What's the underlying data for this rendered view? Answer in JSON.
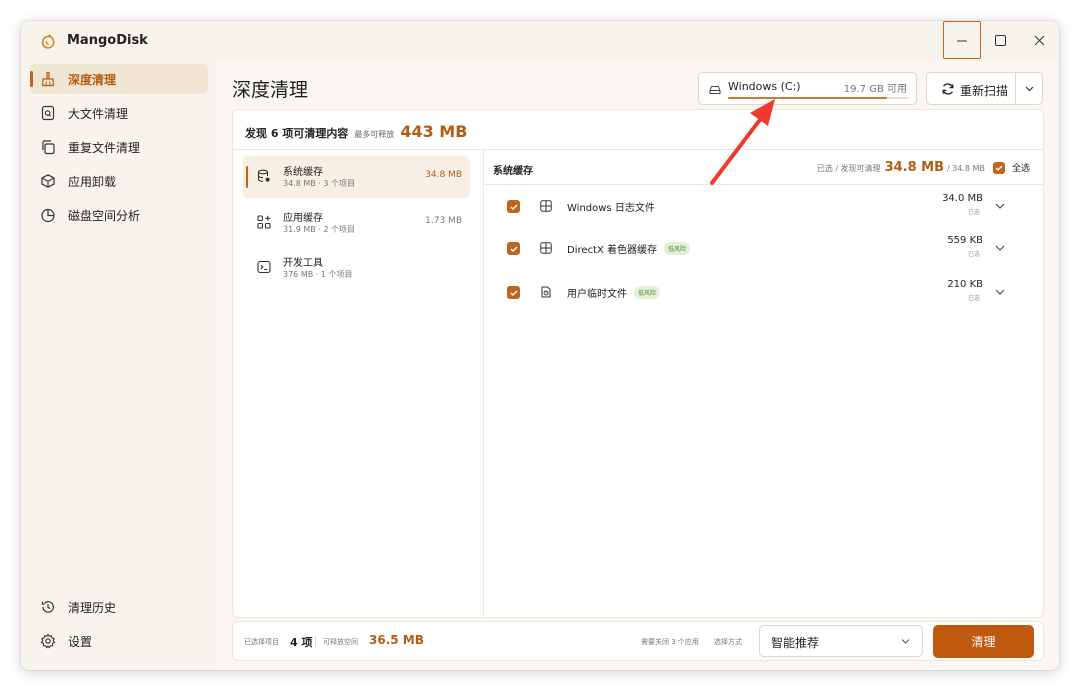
{
  "app": {
    "title": "MangoDisk",
    "logo_icon": "mango-logo-icon"
  },
  "window_controls": {
    "minimize_icon": "minimize-icon",
    "maximize_icon": "maximize-icon",
    "close_icon": "close-icon"
  },
  "sidebar": {
    "items": [
      {
        "label": "深度清理",
        "icon": "broom-icon",
        "active": true
      },
      {
        "label": "大文件清理",
        "icon": "file-search-icon",
        "active": false
      },
      {
        "label": "重复文件清理",
        "icon": "copy-icon",
        "active": false
      },
      {
        "label": "应用卸载",
        "icon": "package-icon",
        "active": false
      },
      {
        "label": "磁盘空间分析",
        "icon": "pie-chart-icon",
        "active": false
      }
    ],
    "bottom": [
      {
        "label": "清理历史",
        "icon": "history-icon"
      },
      {
        "label": "设置",
        "icon": "settings-gear-icon"
      }
    ]
  },
  "header": {
    "title": "深度清理",
    "drive": {
      "name": "Windows (C:)",
      "free": "19.7 GB 可用",
      "used_fraction": 0.88
    },
    "rescan_label": "重新扫描"
  },
  "summary": {
    "found": "发现 6 项可清理内容",
    "max_label": "最多可释放",
    "max_value": "443 MB"
  },
  "categories": [
    {
      "name": "系统缓存",
      "sub": "34.8 MB · 3 个项目",
      "size": "34.8 MB",
      "active": true
    },
    {
      "name": "应用缓存",
      "sub": "31.9 MB · 2 个项目",
      "size": "1.73 MB",
      "active": false
    },
    {
      "name": "开发工具",
      "sub": "376 MB · 1 个项目",
      "size": "",
      "active": false
    }
  ],
  "detail": {
    "title": "系统缓存",
    "stats_label": "已选 / 发现可清理",
    "stats_value": "34.8 MB",
    "stats_total": "/ 34.8 MB",
    "select_all": "全选",
    "items": [
      {
        "name": "Windows 日志文件",
        "badge": "",
        "size": "34.0 MB",
        "sel": "已选"
      },
      {
        "name": "DirectX 着色器缓存",
        "badge": "低风险",
        "size": "559 KB",
        "sel": "已选"
      },
      {
        "name": "用户临时文件",
        "badge": "低风险",
        "size": "210 KB",
        "sel": "已选"
      }
    ]
  },
  "footer": {
    "selected_label": "已选择项目",
    "selected_value": "4 项",
    "release_label": "可释放空间",
    "release_value": "36.5 MB",
    "close_apps": "需要关闭 3 个应用",
    "method_label": "选择方式",
    "strategy": "智能推荐",
    "clean_label": "清理"
  },
  "colors": {
    "accent": "#c0651c",
    "accent_text": "#b35c12",
    "clean_button": "#c0580e",
    "badge_green": "#4e8a34"
  }
}
